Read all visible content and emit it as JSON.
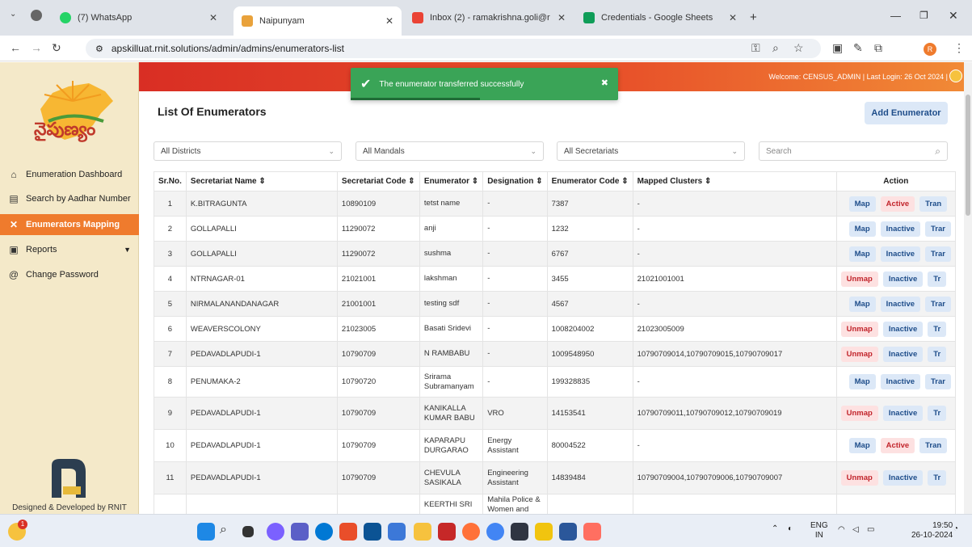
{
  "browser": {
    "tabs": [
      {
        "title": "(7) WhatsApp",
        "color": "#25d366"
      },
      {
        "title": "Naipunyam",
        "color": "#e9a23b"
      },
      {
        "title": "Inbox (2) - ramakrishna.goli@r",
        "color": "#ea4335"
      },
      {
        "title": "Credentials - Google Sheets",
        "color": "#0f9d58"
      }
    ],
    "url": "apskilluat.rnit.solutions/admin/admins/enumerators-list"
  },
  "header": {
    "welcome": "Welcome: CENSUS_ADMIN  |  Last Login: 26 Oct 2024  |"
  },
  "toast": {
    "message": "The enumerator transferred successfully",
    "close": "✖"
  },
  "sidebar": {
    "brand": "నైపుణ్యం",
    "items": [
      {
        "label": "Enumeration Dashboard",
        "icon": "home-icon"
      },
      {
        "label": "Search by Aadhar Number",
        "icon": "search-doc-icon"
      },
      {
        "label": "Enumerators Mapping",
        "icon": "mapping-icon"
      },
      {
        "label": "Reports",
        "icon": "report-icon"
      },
      {
        "label": "Change Password",
        "icon": "at-icon"
      }
    ],
    "footer": "Designed & Developed by RNIT"
  },
  "main": {
    "title": "List Of Enumerators",
    "add_button": "Add Enumerator",
    "filters": {
      "district": "All Districts",
      "mandal": "All Mandals",
      "secretariat": "All Secretariats",
      "search_placeholder": "Search"
    },
    "columns": [
      "Sr.No.",
      "Secretariat Name ⇕",
      "Secretariat Code ⇕",
      "Enumerator ⇕",
      "Designation ⇕",
      "Enumerator Code ⇕",
      "Mapped Clusters ⇕",
      "Action"
    ],
    "rows": [
      {
        "sr": "1",
        "name": "K.BITRAGUNTA",
        "code": "10890109",
        "enum": "tetst name",
        "desig": "-",
        "ecode": "7387",
        "clusters": "-",
        "map": "Map",
        "status": "Active",
        "tran": "Tran"
      },
      {
        "sr": "2",
        "name": "GOLLAPALLI",
        "code": "11290072",
        "enum": "anji",
        "desig": "-",
        "ecode": "1232",
        "clusters": "-",
        "map": "Map",
        "status": "Inactive",
        "tran": "Trar"
      },
      {
        "sr": "3",
        "name": "GOLLAPALLI",
        "code": "11290072",
        "enum": "sushma",
        "desig": "-",
        "ecode": "6767",
        "clusters": "-",
        "map": "Map",
        "status": "Inactive",
        "tran": "Trar"
      },
      {
        "sr": "4",
        "name": "NTRNAGAR-01",
        "code": "21021001",
        "enum": "lakshman",
        "desig": "-",
        "ecode": "3455",
        "clusters": "21021001001",
        "map": "Unmap",
        "status": "Inactive",
        "tran": "Tr"
      },
      {
        "sr": "5",
        "name": "NIRMALANANDANAGAR",
        "code": "21001001",
        "enum": "testing sdf",
        "desig": "-",
        "ecode": "4567",
        "clusters": "-",
        "map": "Map",
        "status": "Inactive",
        "tran": "Trar"
      },
      {
        "sr": "6",
        "name": "WEAVERSCOLONY",
        "code": "21023005",
        "enum": "Basati Sridevi",
        "desig": "-",
        "ecode": "1008204002",
        "clusters": "21023005009",
        "map": "Unmap",
        "status": "Inactive",
        "tran": "Tr"
      },
      {
        "sr": "7",
        "name": "PEDAVADLAPUDI-1",
        "code": "10790709",
        "enum": "N RAMBABU",
        "desig": "-",
        "ecode": "1009548950",
        "clusters": "10790709014,10790709015,10790709017",
        "map": "Unmap",
        "status": "Inactive",
        "tran": "Tr"
      },
      {
        "sr": "8",
        "name": "PENUMAKA-2",
        "code": "10790720",
        "enum": "Srirama Subramanyam",
        "desig": "-",
        "ecode": "199328835",
        "clusters": "-",
        "map": "Map",
        "status": "Inactive",
        "tran": "Trar"
      },
      {
        "sr": "9",
        "name": "PEDAVADLAPUDI-1",
        "code": "10790709",
        "enum": "KANIKALLA KUMAR BABU",
        "desig": "VRO",
        "ecode": "14153541",
        "clusters": "10790709011,10790709012,10790709019",
        "map": "Unmap",
        "status": "Inactive",
        "tran": "Tr"
      },
      {
        "sr": "10",
        "name": "PEDAVADLAPUDI-1",
        "code": "10790709",
        "enum": "KAPARAPU DURGARAO",
        "desig": "Energy Assistant",
        "ecode": "80004522",
        "clusters": "-",
        "map": "Map",
        "status": "Active",
        "tran": "Tran"
      },
      {
        "sr": "11",
        "name": "PEDAVADLAPUDI-1",
        "code": "10790709",
        "enum": "CHEVULA SASIKALA",
        "desig": "Engineering Assistant",
        "ecode": "14839484",
        "clusters": "10790709004,10790709006,10790709007",
        "map": "Unmap",
        "status": "Inactive",
        "tran": "Tr"
      },
      {
        "sr": "",
        "name": "",
        "code": "",
        "enum": "KEERTHI SRI",
        "desig": "Mahila Police & Women and",
        "ecode": "",
        "clusters": "",
        "map": "",
        "status": "",
        "tran": ""
      }
    ]
  },
  "taskbar": {
    "lang": "ENG",
    "region": "IN",
    "time": "19:50",
    "date": "26-10-2024",
    "badge": "1"
  }
}
